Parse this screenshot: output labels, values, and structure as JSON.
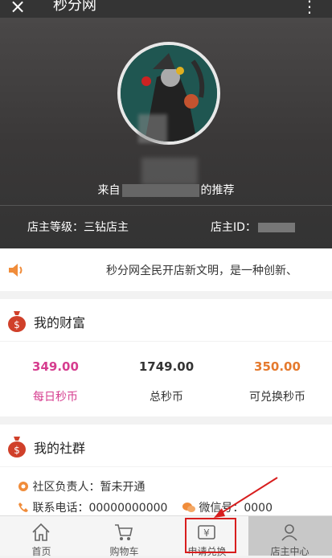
{
  "titlebar": {
    "close_icon": "×",
    "title": "秒分网",
    "more_icon": "⋮"
  },
  "profile": {
    "recommend_prefix": "来自",
    "recommend_suffix": "的推荐",
    "shop_level": "店主等级：三钻店主",
    "shop_id_label": "店主ID："
  },
  "notice": {
    "text": "秒分网全民开店新文明，是一种创新、"
  },
  "wealth": {
    "title": "我的财富",
    "stats": [
      {
        "value": "349.00",
        "label": "每日秒币",
        "color": "#d63d8f"
      },
      {
        "value": "1749.00",
        "label": "总秒币",
        "color": "#333333"
      },
      {
        "value": "350.00",
        "label": "可兑换秒币",
        "color": "#e57a2e"
      }
    ]
  },
  "community": {
    "title": "我的社群",
    "leader": "社区负责人：暂未开通",
    "phone": "联系电话：00000000000",
    "wechat": "微信号：0000"
  },
  "tabs": [
    {
      "label": "首页",
      "icon": "home-icon"
    },
    {
      "label": "购物车",
      "icon": "cart-icon"
    },
    {
      "label": "申请兑换",
      "icon": "exchange-icon"
    },
    {
      "label": "店主中心",
      "icon": "user-icon"
    }
  ],
  "colors": {
    "accent_red": "#d81e1e",
    "orange": "#f08c3a",
    "pink": "#d63d8f"
  }
}
